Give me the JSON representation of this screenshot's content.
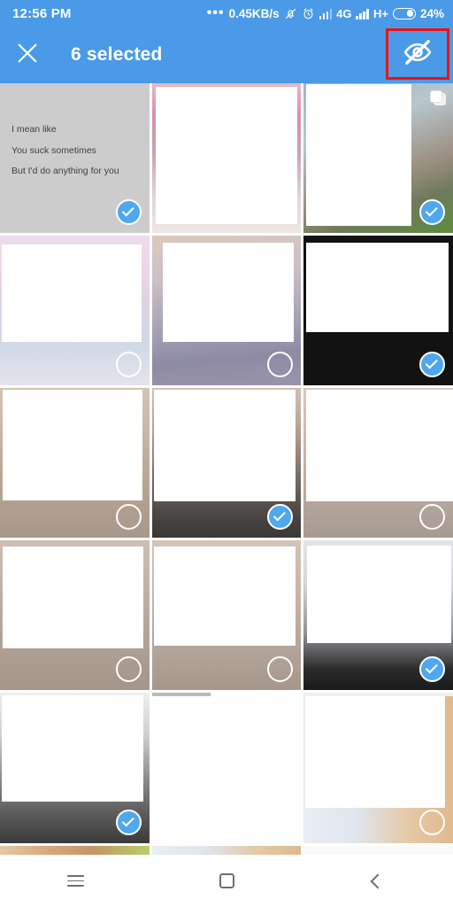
{
  "status_bar": {
    "time": "12:56 PM",
    "dots": "•••",
    "network_speed": "0.45KB/s",
    "mute_icon": "bell-muted-icon",
    "alarm_icon": "alarm-clock-icon",
    "signal1_icon": "signal-bars-icon",
    "network_type": "4G",
    "signal2_icon": "signal-bars-icon",
    "network_type2": "H+",
    "battery_icon": "battery-icon",
    "battery_percent": "24%"
  },
  "app_bar": {
    "close_icon": "close-icon",
    "title": "6 selected",
    "hide_icon": "eye-slash-icon",
    "highlight_color": "#ef1111",
    "background_color": "#4a9ae8"
  },
  "grid": {
    "accent_color": "#4fa8ef",
    "rows": [
      {
        "cells": [
          {
            "type": "text-note",
            "lines": [
              "I mean like",
              "You suck sometimes",
              "But I'd do anything for you"
            ],
            "selected": true,
            "marker": "check-circle-checked"
          },
          {
            "type": "photo",
            "selected": false,
            "marker": "none"
          },
          {
            "type": "photo",
            "selected": true,
            "marker": "check-circle-checked",
            "badge": "stack-icon"
          }
        ]
      },
      {
        "cells": [
          {
            "type": "photo",
            "selected": false,
            "marker": "check-circle-unchecked"
          },
          {
            "type": "photo",
            "selected": false,
            "marker": "check-circle-unchecked"
          },
          {
            "type": "photo",
            "selected": true,
            "marker": "check-circle-checked"
          }
        ]
      },
      {
        "cells": [
          {
            "type": "photo",
            "selected": false,
            "marker": "check-circle-unchecked"
          },
          {
            "type": "photo",
            "selected": true,
            "marker": "check-circle-checked"
          },
          {
            "type": "photo",
            "selected": false,
            "marker": "check-circle-unchecked"
          }
        ]
      },
      {
        "cells": [
          {
            "type": "photo",
            "selected": false,
            "marker": "check-circle-unchecked"
          },
          {
            "type": "photo",
            "selected": false,
            "marker": "check-circle-unchecked"
          },
          {
            "type": "photo",
            "selected": true,
            "marker": "check-circle-checked"
          }
        ]
      },
      {
        "cells": [
          {
            "type": "photo",
            "selected": true,
            "marker": "check-circle-checked"
          },
          {
            "type": "photo",
            "selected": false,
            "marker": "check-circle-unchecked"
          },
          {
            "type": "photo",
            "selected": false,
            "marker": "check-circle-unchecked"
          }
        ]
      },
      {
        "cells": [
          {
            "type": "photo",
            "selected": false,
            "marker": "none"
          },
          {
            "type": "photo",
            "selected": false,
            "marker": "none"
          },
          {
            "type": "photo",
            "selected": false,
            "marker": "none"
          }
        ]
      }
    ]
  },
  "nav_bar": {
    "menu_icon": "menu-icon",
    "home_icon": "home-square-icon",
    "back_icon": "back-chevron-icon"
  }
}
